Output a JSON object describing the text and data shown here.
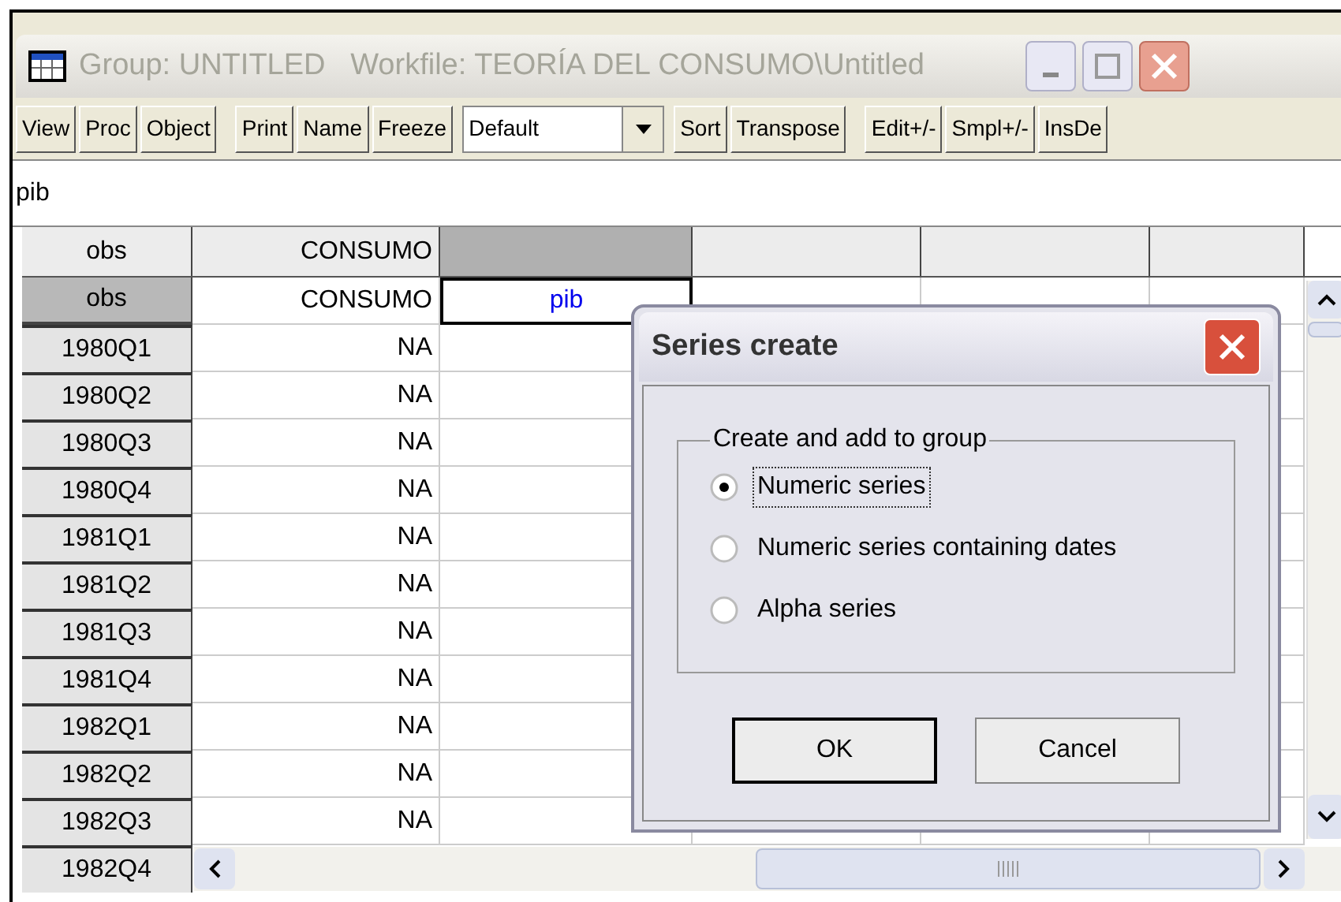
{
  "window": {
    "title": "Group: UNTITLED   Workfile: TEORÍA DEL CONSUMO\\Untitled"
  },
  "toolbar": [
    {
      "kind": "button",
      "label": "View"
    },
    {
      "kind": "button",
      "label": "Proc"
    },
    {
      "kind": "button",
      "label": "Object"
    },
    {
      "kind": "gap"
    },
    {
      "kind": "button",
      "label": "Print"
    },
    {
      "kind": "button",
      "label": "Name"
    },
    {
      "kind": "button",
      "label": "Freeze"
    },
    {
      "kind": "dropdown",
      "value": "Default"
    },
    {
      "kind": "button",
      "label": "Sort"
    },
    {
      "kind": "button",
      "label": "Transpose"
    },
    {
      "kind": "gap"
    },
    {
      "kind": "button",
      "label": "Edit+/-"
    },
    {
      "kind": "button",
      "label": "Smpl+/-"
    },
    {
      "kind": "button",
      "label": "InsDe"
    }
  ],
  "command_field": {
    "value": "pib"
  },
  "grid": {
    "header_row": [
      {
        "label": "obs",
        "selected": false
      },
      {
        "label": "CONSUMO",
        "selected": false
      },
      {
        "selected": true
      },
      {
        "selected": false
      },
      {
        "selected": false
      },
      {
        "selected": false
      }
    ],
    "name_row": [
      {
        "label": "obs",
        "active": false
      },
      {
        "label": "CONSUMO",
        "active": false
      },
      {
        "label": "pib",
        "active": true
      },
      {
        "active": false
      },
      {
        "active": false
      },
      {
        "active": false
      }
    ],
    "rows": [
      {
        "obs": "1980Q1",
        "consumo": "NA"
      },
      {
        "obs": "1980Q2",
        "consumo": "NA"
      },
      {
        "obs": "1980Q3",
        "consumo": "NA"
      },
      {
        "obs": "1980Q4",
        "consumo": "NA"
      },
      {
        "obs": "1981Q1",
        "consumo": "NA"
      },
      {
        "obs": "1981Q2",
        "consumo": "NA"
      },
      {
        "obs": "1981Q3",
        "consumo": "NA"
      },
      {
        "obs": "1981Q4",
        "consumo": "NA"
      },
      {
        "obs": "1982Q1",
        "consumo": "NA"
      },
      {
        "obs": "1982Q2",
        "consumo": "NA"
      },
      {
        "obs": "1982Q3",
        "consumo": "NA"
      },
      {
        "obs": "1982Q4"
      }
    ]
  },
  "dialog": {
    "title": "Series create",
    "group_label": "Create and add to group",
    "options": [
      {
        "label": "Numeric series",
        "selected": true
      },
      {
        "label": "Numeric series containing dates",
        "selected": false
      },
      {
        "label": "Alpha series",
        "selected": false
      }
    ],
    "buttons": [
      {
        "label": "OK",
        "default": true
      },
      {
        "label": "Cancel",
        "default": false
      }
    ]
  }
}
